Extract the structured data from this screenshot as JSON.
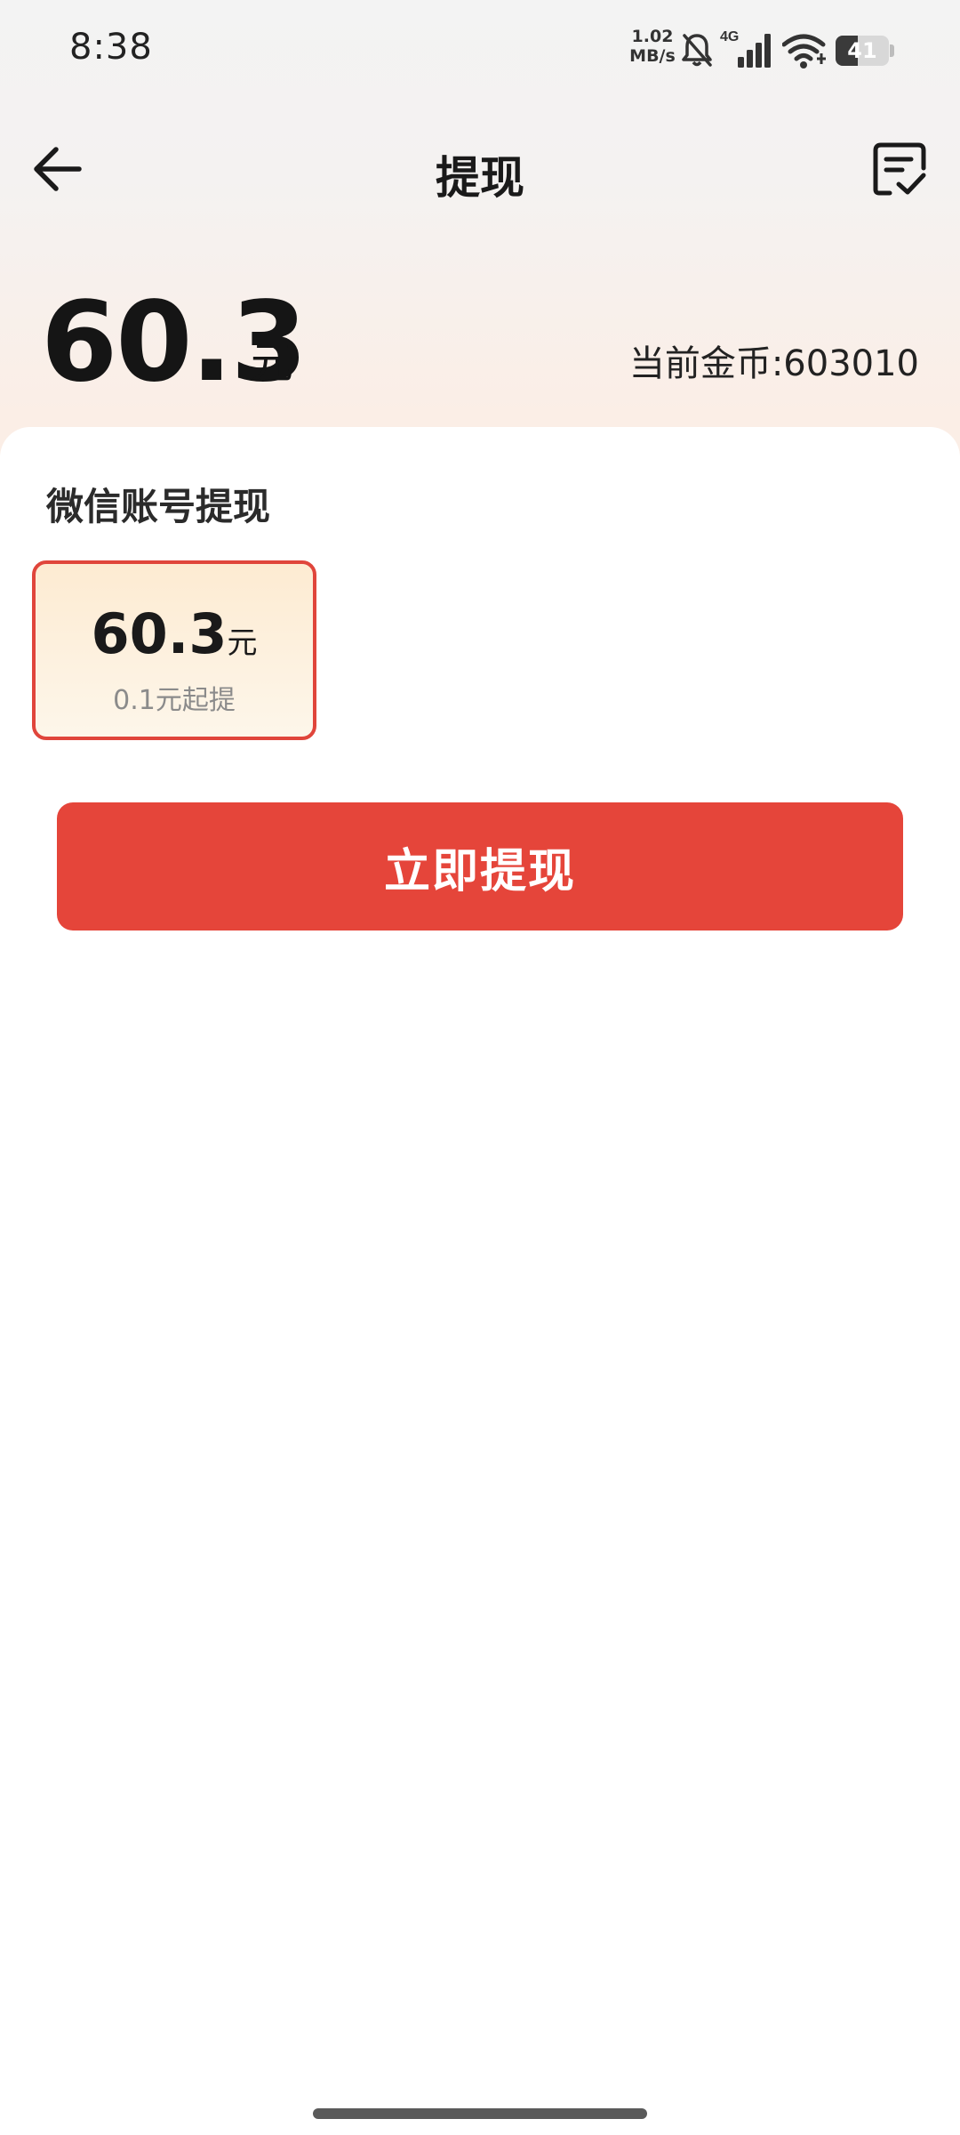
{
  "status_bar": {
    "time": "8:38",
    "net_speed_value": "1.02",
    "net_speed_unit": "MB/s",
    "network_type": "4G",
    "battery_level": "41",
    "battery_fraction": 0.41,
    "icons": [
      "bell-muted-icon",
      "signal-icon",
      "wifi-icon",
      "battery-icon"
    ]
  },
  "header": {
    "title": "提现",
    "back_icon": "arrow-left-icon",
    "record_icon": "withdraw-record-icon"
  },
  "balance": {
    "amount": "60.3",
    "unit": "元",
    "coins_label": "当前金币:603010"
  },
  "withdraw": {
    "section_title": "微信账号提现",
    "options": [
      {
        "amount": "60.3",
        "unit": "元",
        "note": "0.1元起提",
        "selected": true
      }
    ],
    "button_label": "立即提现"
  },
  "colors": {
    "accent": "#e5453a",
    "selected_border": "#e0453b",
    "card_gradient_top": "#fdebd2",
    "card_gradient_bottom": "#fdf6ea"
  }
}
